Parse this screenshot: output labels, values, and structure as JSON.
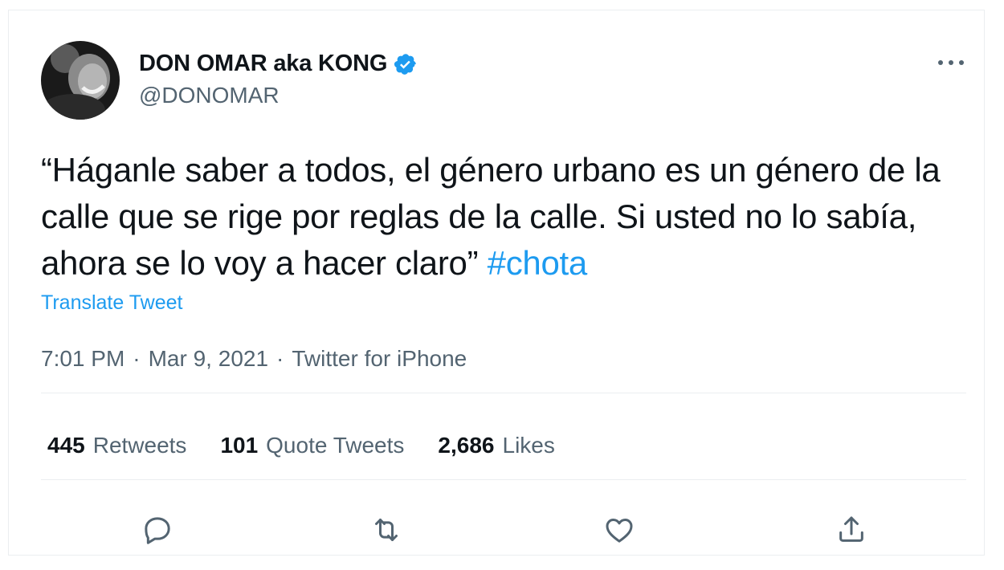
{
  "tweet": {
    "author": {
      "display_name": "DON OMAR aka KONG",
      "handle": "@DONOMAR",
      "verified": true
    },
    "text_main": "“Háganle saber a todos, el género urbano es un género de la calle que se rige por reglas de la calle. Si usted no lo sabía, ahora se lo voy a hacer claro” ",
    "hashtag": "#chota",
    "translate_label": "Translate Tweet",
    "time": "7:01 PM",
    "date": "Mar 9, 2021",
    "separator": "·",
    "source": "Twitter for iPhone",
    "stats": {
      "retweets_count": "445",
      "retweets_label": "Retweets",
      "quotes_count": "101",
      "quotes_label": "Quote Tweets",
      "likes_count": "2,686",
      "likes_label": "Likes"
    },
    "actions": [
      "reply-icon",
      "retweet-icon",
      "like-icon",
      "share-icon"
    ]
  },
  "colors": {
    "text": "#0f1419",
    "secondary": "#536471",
    "accent": "#1d9bf0",
    "border": "#ebeef0"
  }
}
